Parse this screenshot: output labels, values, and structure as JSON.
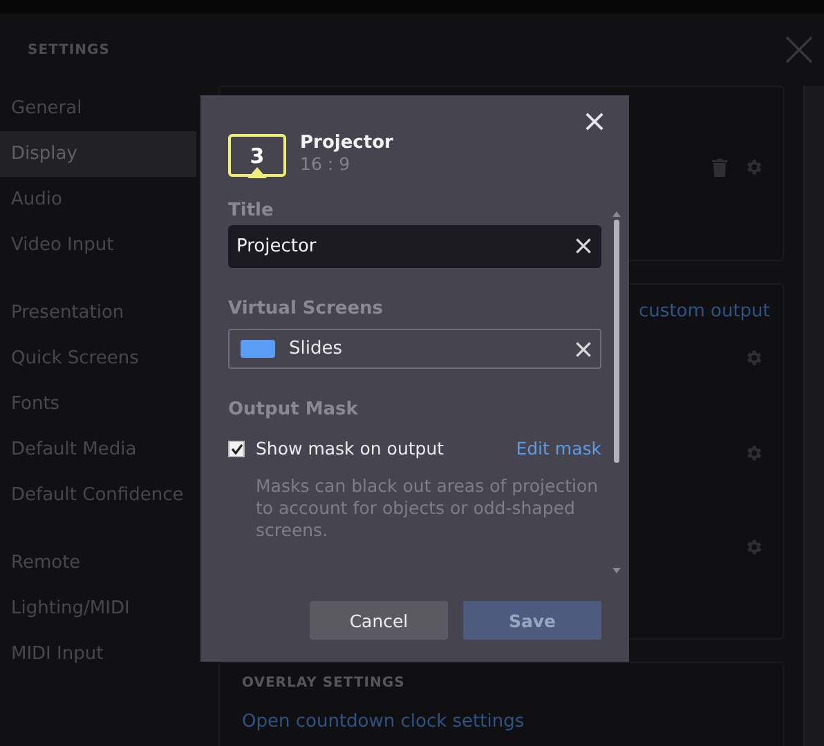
{
  "header": {
    "title": "SETTINGS"
  },
  "sidebar": {
    "groups": [
      {
        "items": [
          {
            "label": "General",
            "selected": false
          },
          {
            "label": "Display",
            "selected": true
          },
          {
            "label": "Audio",
            "selected": false
          },
          {
            "label": "Video Input",
            "selected": false
          }
        ]
      },
      {
        "items": [
          {
            "label": "Presentation",
            "selected": false
          },
          {
            "label": "Quick Screens",
            "selected": false
          },
          {
            "label": "Fonts",
            "selected": false
          },
          {
            "label": "Default Media",
            "selected": false
          },
          {
            "label": "Default Confidence",
            "selected": false
          }
        ]
      },
      {
        "items": [
          {
            "label": "Remote",
            "selected": false
          },
          {
            "label": "Lighting/MIDI",
            "selected": false
          },
          {
            "label": "MIDI Input",
            "selected": false
          }
        ]
      }
    ]
  },
  "content": {
    "custom_output_link": "custom output",
    "overlay_heading": "OVERLAY SETTINGS",
    "countdown_link": "Open countdown clock settings"
  },
  "modal": {
    "screen_number": "3",
    "title": "Projector",
    "aspect": "16 : 9",
    "fields": [
      {
        "label": "Title",
        "kind": "text",
        "value": "Projector"
      },
      {
        "label": "Virtual Screens",
        "kind": "chip",
        "value": "Slides"
      }
    ],
    "output_mask": {
      "heading": "Output Mask",
      "checkbox": {
        "label": "Show mask on output",
        "checked": true
      },
      "link": "Edit mask",
      "description": "Masks can black out areas of projection to account for objects or odd-shaped screens."
    },
    "buttons": [
      {
        "label": "Cancel",
        "kind": "secondary",
        "disabled": false
      },
      {
        "label": "Save",
        "kind": "primary",
        "disabled": true
      }
    ]
  }
}
